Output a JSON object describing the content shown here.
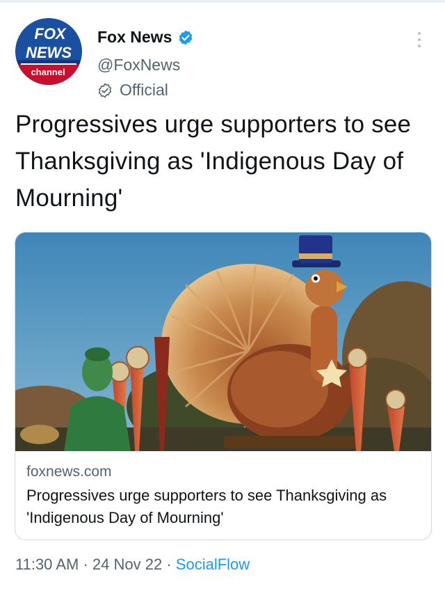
{
  "header": {
    "avatar_lines": [
      "FOX",
      "NEWS",
      "channel"
    ],
    "display_name": "Fox News",
    "handle": "@FoxNews",
    "label": "Official",
    "verified": true,
    "verified_color": "#1d9bf0"
  },
  "tweet": {
    "text": "Progressives urge supporters to see Thanksgiving as 'Indigenous Day of Mourning'"
  },
  "card": {
    "domain": "foxnews.com",
    "title": "Progressives urge supporters to see Thanksgiving as 'Indigenous Day of Mourning'"
  },
  "meta": {
    "time": "11:30 AM",
    "separator": "·",
    "date": "24 Nov 22",
    "source": "SocialFlow"
  },
  "colors": {
    "text_primary": "#0f1419",
    "text_secondary": "#536471",
    "link": "#1d9bf0",
    "border": "#cfd9de",
    "fox_blue": "#0a3a85",
    "fox_red": "#c8102e"
  },
  "icons": [
    "verified-badge-icon",
    "official-badge-icon",
    "more-options-icon"
  ]
}
